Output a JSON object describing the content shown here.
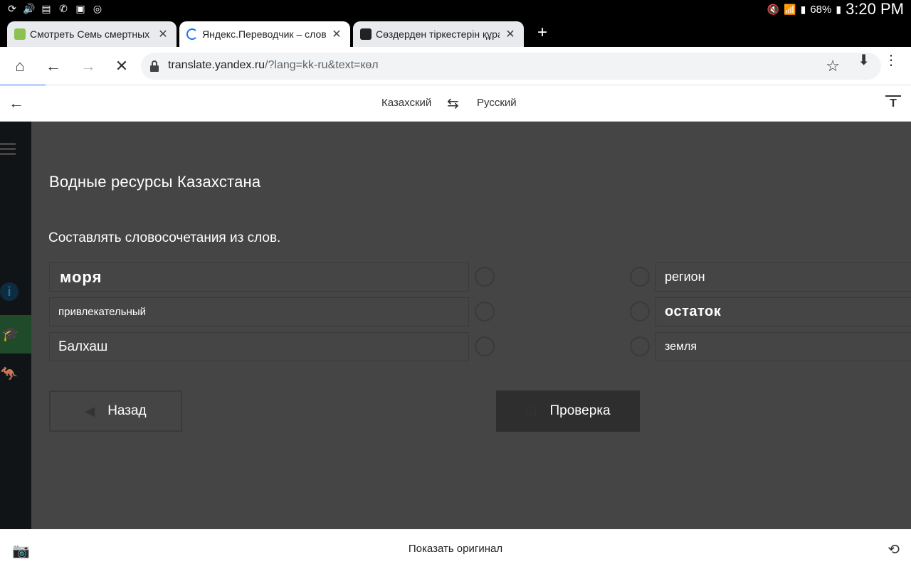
{
  "status_bar": {
    "battery": "68%",
    "time": "3:20 PM"
  },
  "tabs": [
    {
      "title": "Смотреть Семь смертных г",
      "active": false
    },
    {
      "title": "Яндекс.Переводчик – слов",
      "active": true
    },
    {
      "title": "Сөздерден тіркестерін құра",
      "active": false
    }
  ],
  "url_bar": {
    "host": "translate.yandex.ru",
    "path": "/?lang=kk-ru&text=көл"
  },
  "translate_bar": {
    "source_lang": "Казахский",
    "target_lang": "Русский"
  },
  "page": {
    "title": "Водные ресурсы Казахстана",
    "instruction": "Составлять словосочетания из слов.",
    "left_words": [
      "моря",
      "привлекательный",
      "Балхаш"
    ],
    "right_words": [
      "регион",
      "остаток",
      "земля"
    ],
    "back_button": "Назад",
    "check_button": "Проверка"
  },
  "bottom_bar": {
    "label": "Показать оригинал"
  },
  "colors": {
    "accent": "#1a73e8",
    "page_bg": "#454545",
    "rail_bg": "#111417"
  }
}
